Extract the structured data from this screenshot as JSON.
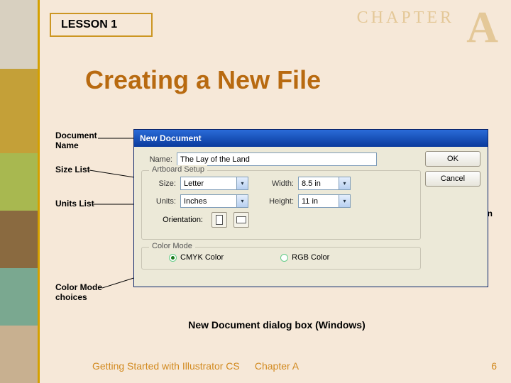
{
  "header": {
    "chapter_word": "CHAPTER",
    "chapter_letter": "A",
    "lesson": "LESSON 1"
  },
  "title": "Creating a New File",
  "callouts": {
    "doc_name": "Document Name",
    "size_list": "Size List",
    "units_list": "Units List",
    "orientation": "Orientation choices",
    "color_mode": "Color Mode choices"
  },
  "dialog": {
    "title": "New Document",
    "name_label": "Name:",
    "name_value": "The Lay of the Land",
    "ok": "OK",
    "cancel": "Cancel",
    "artboard_legend": "Artboard Setup",
    "size_label": "Size:",
    "size_value": "Letter",
    "width_label": "Width:",
    "width_value": "8.5 in",
    "units_label": "Units:",
    "units_value": "Inches",
    "height_label": "Height:",
    "height_value": "11 in",
    "orientation_label": "Orientation:",
    "color_legend": "Color Mode",
    "cmyk": "CMYK Color",
    "rgb": "RGB Color"
  },
  "caption": "New Document dialog box (Windows)",
  "footer": {
    "left": "Getting Started with Illustrator CS",
    "center": "Chapter A",
    "right": "6"
  }
}
